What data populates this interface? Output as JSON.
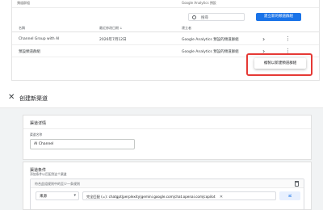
{
  "top_table": {
    "header_left": "頻道群組",
    "header_right": "Google Analytics 預設",
    "search_placeholder": "搜尋",
    "create_button": "建立新的頻道群組",
    "columns": [
      "名稱",
      "最近修改日期 ↓",
      "建立者"
    ],
    "rows": [
      {
        "name": "Channel Group with AI",
        "date": "2026年7月12日",
        "creator": "Google Analytics 預設的頻道群組"
      },
      {
        "name": "預設頻道群組",
        "date": "",
        "creator": "Google Analytics 預設的頻道群組"
      }
    ],
    "context_menu_item": "複製以新建頻道群組",
    "highlight_color": "#e53935",
    "accent_color": "#1a73e8"
  },
  "dialog": {
    "title": "创建新渠道",
    "details_card": {
      "title": "渠道详情",
      "name_label": "渠道名称",
      "name_value": "AI Channel"
    },
    "conditions_card": {
      "title": "渠道条件",
      "subtitle": "添加条件以匹配到这个渠道",
      "group_header": "符合此组规则中的至少一条规则",
      "dimension": "来源",
      "value": "完全匹配 (=): chatgpt|perplexity|gemini.google.com|chat.openai.com|copilot",
      "match_symbol": "≤"
    }
  }
}
